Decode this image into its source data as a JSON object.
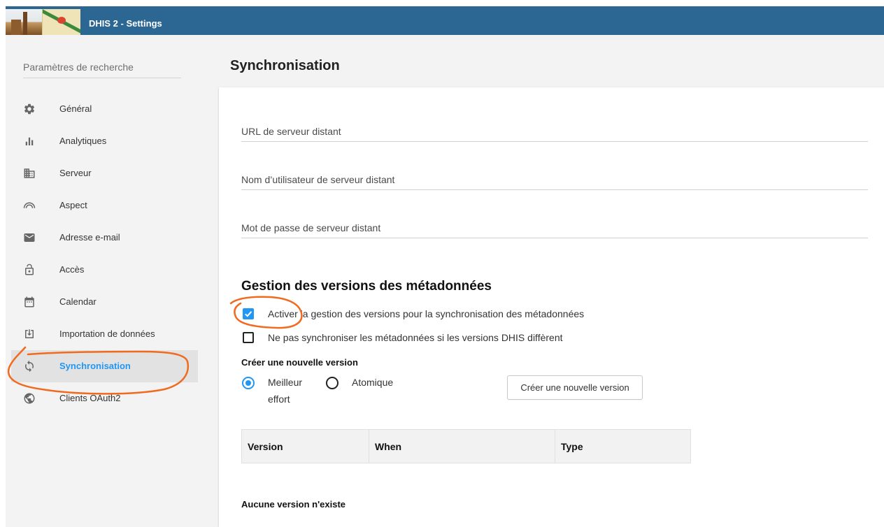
{
  "colors": {
    "header_bg": "#2c6693",
    "accent": "#2196f3",
    "annotation": "#f06a1f"
  },
  "header": {
    "title": "DHIS 2 - Settings",
    "logo_icon": "instance-logo"
  },
  "sidebar": {
    "search_placeholder": "Paramètres de recherche",
    "items": [
      {
        "label": "Général",
        "icon": "gear-icon",
        "active": false
      },
      {
        "label": "Analytiques",
        "icon": "bar-chart-icon",
        "active": false
      },
      {
        "label": "Serveur",
        "icon": "building-icon",
        "active": false
      },
      {
        "label": "Aspect",
        "icon": "rainbow-icon",
        "active": false
      },
      {
        "label": "Adresse e-mail",
        "icon": "envelope-icon",
        "active": false
      },
      {
        "label": "Accès",
        "icon": "lock-open-icon",
        "active": false
      },
      {
        "label": "Calendar",
        "icon": "calendar-icon",
        "active": false
      },
      {
        "label": "Importation de données",
        "icon": "import-icon",
        "active": false
      },
      {
        "label": "Synchronisation",
        "icon": "sync-icon",
        "active": true
      },
      {
        "label": "Clients OAuth2",
        "icon": "globe-icon",
        "active": false
      }
    ]
  },
  "page": {
    "title": "Synchronisation"
  },
  "remote_server": {
    "url": {
      "label": "URL de serveur distant",
      "value": ""
    },
    "username": {
      "label": "Nom d’utilisateur de serveur distant",
      "value": ""
    },
    "password": {
      "label": "Mot de passe de serveur distant",
      "value": ""
    }
  },
  "versioning": {
    "heading": "Gestion des versions des métadonnées",
    "enable_versioning": {
      "label": "Activer la gestion des versions pour la synchronisation des métadonnées",
      "checked": true
    },
    "skip_on_mismatch": {
      "label": "Ne pas synchroniser les métadonnées si les versions DHIS diffèrent",
      "checked": false
    },
    "create_heading": "Créer une nouvelle version",
    "version_types": [
      {
        "label": "Meilleur effort",
        "selected": true
      },
      {
        "label": "Atomique",
        "selected": false
      }
    ],
    "create_button": "Créer une nouvelle version",
    "table": {
      "columns": [
        "Version",
        "When",
        "Type"
      ],
      "rows": []
    },
    "empty_message": "Aucune version n'existe"
  }
}
